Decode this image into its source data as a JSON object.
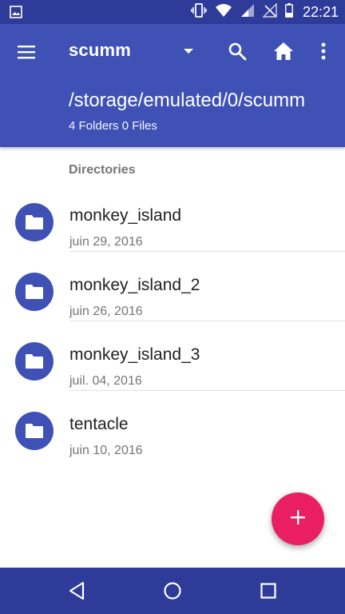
{
  "status_bar": {
    "time": "22:21",
    "icons": [
      "image-notification-icon",
      "vibrate-icon",
      "wifi-icon",
      "cell-signal-icon",
      "no-signal-icon",
      "battery-icon"
    ]
  },
  "app_bar": {
    "title": "scumm",
    "path": "/storage/emulated/0/scumm",
    "counts": "4 Folders 0 Files",
    "actions": [
      "menu-icon",
      "search-icon",
      "home-icon",
      "more-vert-icon"
    ]
  },
  "section_header": "Directories",
  "folders": [
    {
      "name": "monkey_island",
      "date": "juin 29, 2016"
    },
    {
      "name": "monkey_island_2",
      "date": "juin 26, 2016"
    },
    {
      "name": "monkey_island_3",
      "date": "juil. 04, 2016"
    },
    {
      "name": "tentacle",
      "date": "juin 10, 2016"
    }
  ],
  "fab": {
    "icon": "add-icon"
  },
  "nav_bar": {
    "buttons": [
      "back-icon",
      "home-circle-icon",
      "recents-icon"
    ]
  },
  "colors": {
    "primary": "#3f51b5",
    "primary_dark": "#2f3b99",
    "accent": "#e91e63"
  }
}
